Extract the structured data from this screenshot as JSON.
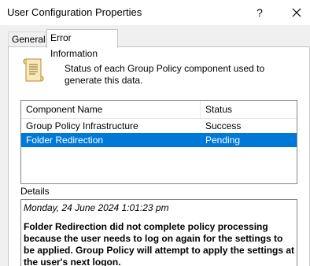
{
  "window": {
    "title": "User Configuration Properties",
    "help_label": "?"
  },
  "tabs": [
    {
      "label": "General",
      "selected": false
    },
    {
      "label": "Error Information",
      "selected": true
    }
  ],
  "description": "Status of each Group Policy component used to generate this data.",
  "list": {
    "columns": [
      "Component Name",
      "Status"
    ],
    "rows": [
      {
        "component": "Group Policy Infrastructure",
        "status": "Success",
        "selected": false
      },
      {
        "component": "Folder Redirection",
        "status": "Pending",
        "selected": true
      }
    ]
  },
  "details": {
    "label": "Details",
    "date": "Monday, 24 June 2024 1:01:23 pm",
    "message": "Folder Redirection did not complete policy processing because the user needs to log on again for the settings to be applied.  Group Policy will attempt to apply the settings at the user's next logon."
  },
  "colors": {
    "selection": "#0078d7",
    "titlebar": "#ffffff",
    "dialog_bg": "#f0f0f0"
  }
}
